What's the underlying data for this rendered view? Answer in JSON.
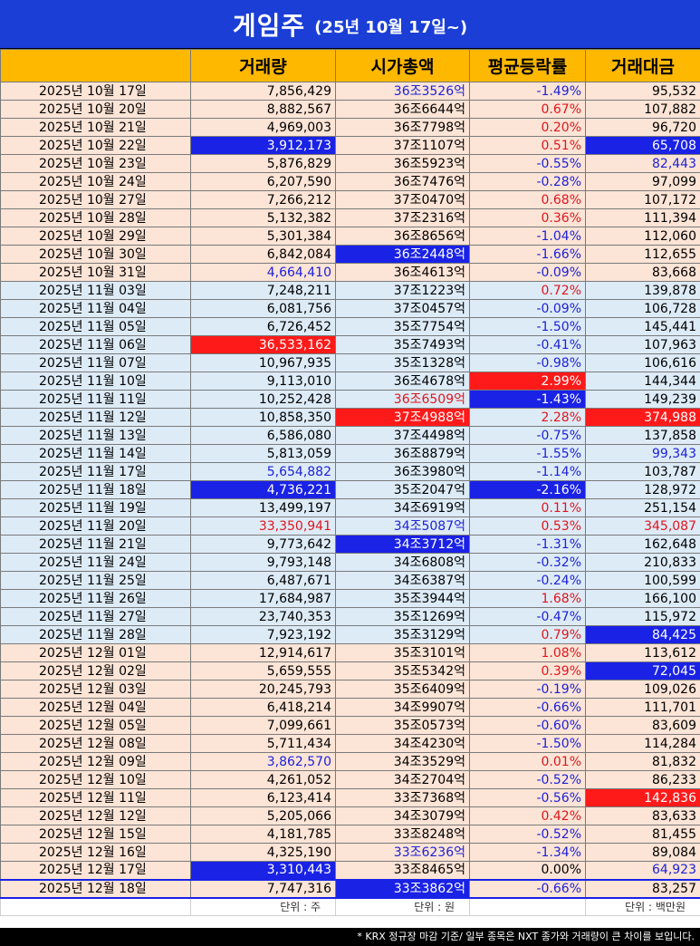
{
  "title": {
    "main": "게임주",
    "sub": "(25년 10월 17일~)"
  },
  "headers": [
    "",
    "거래량",
    "시가총액",
    "평균등락률",
    "거래대금"
  ],
  "units": [
    "",
    "단위 : 주",
    "단위 : 원",
    "",
    "단위 : 백만원"
  ],
  "footer_note": "* KRX 정규장 마감 기준/ 일부 종목은 NXT 종가와 거래량이 큰 차이를 보입니다.",
  "colors": {
    "title_bg": "#1a3ed6",
    "header_bg": "#ffb800",
    "oct_dec_row": "#fce4d6",
    "nov_row": "#ddebf7",
    "highlight_blue": "#1a22e6",
    "highlight_red": "#ff1a1a",
    "text_blue": "#1e22d8",
    "text_red": "#e0161d"
  },
  "rows": [
    {
      "date": "2025년 10월 17일",
      "volume": "7,856,429",
      "mcap": "36조3526억",
      "rate": "-1.49%",
      "amount": "95,532",
      "group": "oct",
      "style": {
        "mcap": "blue-text",
        "rate": "blue-text"
      }
    },
    {
      "date": "2025년 10월 20일",
      "volume": "8,882,567",
      "mcap": "36조6644억",
      "rate": "0.67%",
      "amount": "107,882",
      "group": "oct",
      "style": {
        "rate": "red-text"
      }
    },
    {
      "date": "2025년 10월 21일",
      "volume": "4,969,003",
      "mcap": "36조7798억",
      "rate": "0.20%",
      "amount": "96,720",
      "group": "oct",
      "style": {
        "rate": "red-text"
      }
    },
    {
      "date": "2025년 10월 22일",
      "volume": "3,912,173",
      "mcap": "37조1107억",
      "rate": "0.51%",
      "amount": "65,708",
      "group": "oct",
      "style": {
        "volume": "hl-blue",
        "rate": "red-text",
        "amount": "hl-blue"
      }
    },
    {
      "date": "2025년 10월 23일",
      "volume": "5,876,829",
      "mcap": "36조5923억",
      "rate": "-0.55%",
      "amount": "82,443",
      "group": "oct",
      "style": {
        "rate": "blue-text",
        "amount": "blue-text"
      }
    },
    {
      "date": "2025년 10월 24일",
      "volume": "6,207,590",
      "mcap": "36조7476억",
      "rate": "-0.28%",
      "amount": "97,099",
      "group": "oct",
      "style": {
        "rate": "blue-text"
      }
    },
    {
      "date": "2025년 10월 27일",
      "volume": "7,266,212",
      "mcap": "37조0470억",
      "rate": "0.68%",
      "amount": "107,172",
      "group": "oct",
      "style": {
        "rate": "red-text"
      }
    },
    {
      "date": "2025년 10월 28일",
      "volume": "5,132,382",
      "mcap": "37조2316억",
      "rate": "0.36%",
      "amount": "111,394",
      "group": "oct",
      "style": {
        "rate": "red-text"
      }
    },
    {
      "date": "2025년 10월 29일",
      "volume": "5,301,384",
      "mcap": "36조8656억",
      "rate": "-1.04%",
      "amount": "112,060",
      "group": "oct",
      "style": {
        "rate": "blue-text"
      }
    },
    {
      "date": "2025년 10월 30일",
      "volume": "6,842,084",
      "mcap": "36조2448억",
      "rate": "-1.66%",
      "amount": "112,655",
      "group": "oct",
      "style": {
        "mcap": "hl-blue",
        "rate": "blue-text"
      }
    },
    {
      "date": "2025년 10월 31일",
      "volume": "4,664,410",
      "mcap": "36조4613억",
      "rate": "-0.09%",
      "amount": "83,668",
      "group": "oct",
      "style": {
        "volume": "blue-text",
        "rate": "blue-text"
      }
    },
    {
      "date": "2025년 11월 03일",
      "volume": "7,248,211",
      "mcap": "37조1223억",
      "rate": "0.72%",
      "amount": "139,878",
      "group": "nov",
      "style": {
        "rate": "red-text"
      }
    },
    {
      "date": "2025년 11월 04일",
      "volume": "6,081,756",
      "mcap": "37조0457억",
      "rate": "-0.09%",
      "amount": "106,728",
      "group": "nov",
      "style": {
        "rate": "blue-text"
      }
    },
    {
      "date": "2025년 11월 05일",
      "volume": "6,726,452",
      "mcap": "35조7754억",
      "rate": "-1.50%",
      "amount": "145,441",
      "group": "nov",
      "style": {
        "rate": "blue-text"
      }
    },
    {
      "date": "2025년 11월 06일",
      "volume": "36,533,162",
      "mcap": "35조7493억",
      "rate": "-0.41%",
      "amount": "107,963",
      "group": "nov",
      "style": {
        "volume": "hl-red",
        "rate": "blue-text"
      }
    },
    {
      "date": "2025년 11월 07일",
      "volume": "10,967,935",
      "mcap": "35조1328억",
      "rate": "-0.98%",
      "amount": "106,616",
      "group": "nov",
      "style": {
        "rate": "blue-text"
      }
    },
    {
      "date": "2025년 11월 10일",
      "volume": "9,113,010",
      "mcap": "36조4678억",
      "rate": "2.99%",
      "amount": "144,344",
      "group": "nov",
      "style": {
        "rate": "hl-red"
      }
    },
    {
      "date": "2025년 11월 11일",
      "volume": "10,252,428",
      "mcap": "36조6509억",
      "rate": "-1.43%",
      "amount": "149,239",
      "group": "nov",
      "style": {
        "mcap": "red-text",
        "rate": "hl-blue"
      }
    },
    {
      "date": "2025년 11월 12일",
      "volume": "10,858,350",
      "mcap": "37조4988억",
      "rate": "2.28%",
      "amount": "374,988",
      "group": "nov",
      "style": {
        "mcap": "hl-red",
        "rate": "red-text",
        "amount": "hl-red"
      }
    },
    {
      "date": "2025년 11월 13일",
      "volume": "6,586,080",
      "mcap": "37조4498억",
      "rate": "-0.75%",
      "amount": "137,858",
      "group": "nov",
      "style": {
        "rate": "blue-text"
      }
    },
    {
      "date": "2025년 11월 14일",
      "volume": "5,813,059",
      "mcap": "36조8879억",
      "rate": "-1.55%",
      "amount": "99,343",
      "group": "nov",
      "style": {
        "rate": "blue-text",
        "amount": "blue-text"
      }
    },
    {
      "date": "2025년 11월 17일",
      "volume": "5,654,882",
      "mcap": "36조3980억",
      "rate": "-1.14%",
      "amount": "103,787",
      "group": "nov",
      "style": {
        "volume": "blue-text",
        "rate": "blue-text"
      }
    },
    {
      "date": "2025년 11월 18일",
      "volume": "4,736,221",
      "mcap": "35조2047억",
      "rate": "-2.16%",
      "amount": "128,972",
      "group": "nov",
      "style": {
        "volume": "hl-blue",
        "rate": "hl-blue"
      }
    },
    {
      "date": "2025년 11월 19일",
      "volume": "13,499,197",
      "mcap": "34조6919억",
      "rate": "0.11%",
      "amount": "251,154",
      "group": "nov",
      "style": {
        "rate": "red-text"
      }
    },
    {
      "date": "2025년 11월 20일",
      "volume": "33,350,941",
      "mcap": "34조5087억",
      "rate": "0.53%",
      "amount": "345,087",
      "group": "nov",
      "style": {
        "volume": "red-text",
        "mcap": "blue-text",
        "rate": "red-text",
        "amount": "red-text"
      }
    },
    {
      "date": "2025년 11월 21일",
      "volume": "9,773,642",
      "mcap": "34조3712억",
      "rate": "-1.31%",
      "amount": "162,648",
      "group": "nov",
      "style": {
        "mcap": "hl-blue",
        "rate": "blue-text"
      }
    },
    {
      "date": "2025년 11월 24일",
      "volume": "9,793,148",
      "mcap": "34조6808억",
      "rate": "-0.32%",
      "amount": "210,833",
      "group": "nov",
      "style": {
        "rate": "blue-text"
      }
    },
    {
      "date": "2025년 11월 25일",
      "volume": "6,487,671",
      "mcap": "34조6387억",
      "rate": "-0.24%",
      "amount": "100,599",
      "group": "nov",
      "style": {
        "rate": "blue-text"
      }
    },
    {
      "date": "2025년 11월 26일",
      "volume": "17,684,987",
      "mcap": "35조3944억",
      "rate": "1.68%",
      "amount": "166,100",
      "group": "nov",
      "style": {
        "rate": "red-text"
      }
    },
    {
      "date": "2025년 11월 27일",
      "volume": "23,740,353",
      "mcap": "35조1269억",
      "rate": "-0.47%",
      "amount": "115,972",
      "group": "nov",
      "style": {
        "rate": "blue-text"
      }
    },
    {
      "date": "2025년 11월 28일",
      "volume": "7,923,192",
      "mcap": "35조3129억",
      "rate": "0.79%",
      "amount": "84,425",
      "group": "nov",
      "style": {
        "rate": "red-text",
        "amount": "hl-blue"
      }
    },
    {
      "date": "2025년 12월 01일",
      "volume": "12,914,617",
      "mcap": "35조3101억",
      "rate": "1.08%",
      "amount": "113,612",
      "group": "dec",
      "style": {
        "rate": "red-text"
      }
    },
    {
      "date": "2025년 12월 02일",
      "volume": "5,659,555",
      "mcap": "35조5342억",
      "rate": "0.39%",
      "amount": "72,045",
      "group": "dec",
      "style": {
        "rate": "red-text",
        "amount": "hl-blue"
      }
    },
    {
      "date": "2025년 12월 03일",
      "volume": "20,245,793",
      "mcap": "35조6409억",
      "rate": "-0.19%",
      "amount": "109,026",
      "group": "dec",
      "style": {
        "rate": "blue-text"
      }
    },
    {
      "date": "2025년 12월 04일",
      "volume": "6,418,214",
      "mcap": "34조9907억",
      "rate": "-0.66%",
      "amount": "111,701",
      "group": "dec",
      "style": {
        "rate": "blue-text"
      }
    },
    {
      "date": "2025년 12월 05일",
      "volume": "7,099,661",
      "mcap": "35조0573억",
      "rate": "-0.60%",
      "amount": "83,609",
      "group": "dec",
      "style": {
        "rate": "blue-text"
      }
    },
    {
      "date": "2025년 12월 08일",
      "volume": "5,711,434",
      "mcap": "34조4230억",
      "rate": "-1.50%",
      "amount": "114,284",
      "group": "dec",
      "style": {
        "rate": "blue-text"
      }
    },
    {
      "date": "2025년 12월 09일",
      "volume": "3,862,570",
      "mcap": "34조3529억",
      "rate": "0.01%",
      "amount": "81,832",
      "group": "dec",
      "style": {
        "volume": "blue-text",
        "rate": "red-text"
      }
    },
    {
      "date": "2025년 12월 10일",
      "volume": "4,261,052",
      "mcap": "34조2704억",
      "rate": "-0.52%",
      "amount": "86,233",
      "group": "dec",
      "style": {
        "rate": "blue-text"
      }
    },
    {
      "date": "2025년 12월 11일",
      "volume": "6,123,414",
      "mcap": "33조7368억",
      "rate": "-0.56%",
      "amount": "142,836",
      "group": "dec",
      "style": {
        "rate": "blue-text",
        "amount": "hl-red"
      }
    },
    {
      "date": "2025년 12월 12일",
      "volume": "5,205,066",
      "mcap": "34조3079억",
      "rate": "0.42%",
      "amount": "83,633",
      "group": "dec",
      "style": {
        "rate": "red-text"
      }
    },
    {
      "date": "2025년 12월 15일",
      "volume": "4,181,785",
      "mcap": "33조8248억",
      "rate": "-0.52%",
      "amount": "81,455",
      "group": "dec",
      "style": {
        "rate": "blue-text"
      }
    },
    {
      "date": "2025년 12월 16일",
      "volume": "4,325,190",
      "mcap": "33조6236억",
      "rate": "-1.34%",
      "amount": "89,084",
      "group": "dec",
      "style": {
        "mcap": "blue-text",
        "rate": "blue-text"
      }
    },
    {
      "date": "2025년 12월 17일",
      "volume": "3,310,443",
      "mcap": "33조8465억",
      "rate": "0.00%",
      "amount": "64,923",
      "group": "dec",
      "style": {
        "volume": "hl-blue",
        "amount": "blue-text"
      }
    },
    {
      "date": "2025년 12월 18일",
      "volume": "7,747,316",
      "mcap": "33조3862억",
      "rate": "-0.66%",
      "amount": "83,257",
      "group": "dec",
      "style": {
        "mcap": "hl-blue",
        "rate": "blue-text"
      },
      "last": true
    }
  ]
}
